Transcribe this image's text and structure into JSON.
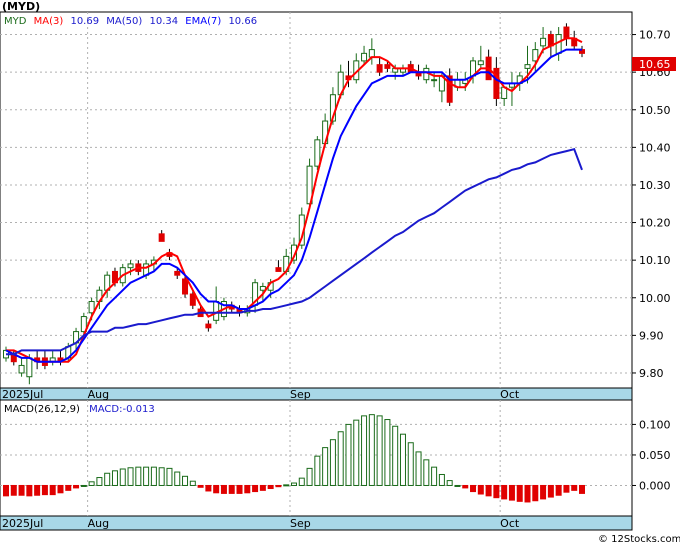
{
  "ticker_label": "(MYD)",
  "legend": {
    "symbol": "MYD",
    "ma3_label": "MA(3)",
    "ma3_value": "10.69",
    "ma50_label": "MA(50)",
    "ma50_value": "10.34",
    "ema7_label": "EMA(7)",
    "ema7_value": "10.66"
  },
  "price_badge": "10.65",
  "macd_legend": {
    "label": "MACD(26,12,9)",
    "value_label": "MACD:-0.013"
  },
  "watermark": "© 12Stocks.com",
  "colors": {
    "up": "#1a6b1a",
    "down": "#e00000",
    "ma3": "#ff0000",
    "ma50": "#1a1acd",
    "ema7": "#0000ff",
    "band": "#a8d8e8",
    "badge": "#e00000"
  },
  "chart_data": [
    {
      "type": "candlestick",
      "title": "",
      "ylim": [
        9.76,
        10.76
      ],
      "y_ticks": [
        9.8,
        9.9,
        10.0,
        10.1,
        10.2,
        10.3,
        10.4,
        10.5,
        10.6,
        10.7
      ],
      "y_tick_labels": [
        "9.80",
        "9.90",
        "10.00",
        "10.10",
        "10.20",
        "10.30",
        "10.40",
        "10.50",
        "10.60",
        "10.70"
      ],
      "x_labels": [
        {
          "label": "2025Jul",
          "index": 0
        },
        {
          "label": "Aug",
          "index": 11
        },
        {
          "label": "Sep",
          "index": 37
        },
        {
          "label": "Oct",
          "index": 64
        }
      ],
      "candles": [
        [
          9.84,
          9.87,
          9.83,
          9.86
        ],
        [
          9.85,
          9.86,
          9.82,
          9.83
        ],
        [
          9.8,
          9.84,
          9.79,
          9.82
        ],
        [
          9.79,
          9.85,
          9.77,
          9.84
        ],
        [
          9.84,
          9.86,
          9.81,
          9.83
        ],
        [
          9.84,
          9.86,
          9.81,
          9.82
        ],
        [
          9.83,
          9.86,
          9.82,
          9.84
        ],
        [
          9.84,
          9.86,
          9.82,
          9.83
        ],
        [
          9.84,
          9.88,
          9.83,
          9.87
        ],
        [
          9.88,
          9.92,
          9.86,
          9.91
        ],
        [
          9.91,
          9.96,
          9.9,
          9.95
        ],
        [
          9.96,
          10.0,
          9.94,
          9.99
        ],
        [
          9.99,
          10.03,
          9.97,
          10.02
        ],
        [
          10.02,
          10.07,
          10.0,
          10.06
        ],
        [
          10.07,
          10.08,
          10.03,
          10.04
        ],
        [
          10.04,
          10.09,
          10.03,
          10.08
        ],
        [
          10.08,
          10.1,
          10.06,
          10.09
        ],
        [
          10.09,
          10.1,
          10.06,
          10.07
        ],
        [
          10.06,
          10.1,
          10.05,
          10.09
        ],
        [
          10.09,
          10.11,
          10.07,
          10.1
        ],
        [
          10.17,
          10.18,
          10.15,
          10.15
        ],
        [
          10.12,
          10.13,
          10.1,
          10.11
        ],
        [
          10.07,
          10.08,
          10.05,
          10.06
        ],
        [
          10.05,
          10.06,
          10.0,
          10.01
        ],
        [
          10.01,
          10.02,
          9.97,
          9.98
        ],
        [
          9.97,
          9.98,
          9.95,
          9.95
        ],
        [
          9.93,
          9.94,
          9.91,
          9.92
        ],
        [
          9.94,
          10.03,
          9.93,
          9.99
        ],
        [
          9.95,
          10.0,
          9.94,
          9.99
        ],
        [
          9.98,
          9.99,
          9.96,
          9.97
        ],
        [
          9.97,
          9.98,
          9.95,
          9.96
        ],
        [
          9.96,
          9.98,
          9.95,
          9.97
        ],
        [
          9.98,
          10.05,
          9.96,
          10.04
        ],
        [
          10.02,
          10.04,
          9.99,
          10.03
        ],
        [
          10.02,
          10.05,
          10.0,
          10.04
        ],
        [
          10.08,
          10.1,
          10.07,
          10.07
        ],
        [
          10.07,
          10.13,
          10.06,
          10.11
        ],
        [
          10.1,
          10.16,
          10.09,
          10.14
        ],
        [
          10.14,
          10.24,
          10.13,
          10.22
        ],
        [
          10.25,
          10.37,
          10.24,
          10.35
        ],
        [
          10.35,
          10.43,
          10.34,
          10.42
        ],
        [
          10.41,
          10.49,
          10.4,
          10.47
        ],
        [
          10.47,
          10.56,
          10.46,
          10.54
        ],
        [
          10.54,
          10.62,
          10.53,
          10.6
        ],
        [
          10.59,
          10.63,
          10.56,
          10.58
        ],
        [
          10.58,
          10.65,
          10.57,
          10.63
        ],
        [
          10.63,
          10.67,
          10.62,
          10.65
        ],
        [
          10.64,
          10.69,
          10.62,
          10.66
        ],
        [
          10.62,
          10.64,
          10.59,
          10.6
        ],
        [
          10.62,
          10.63,
          10.6,
          10.61
        ],
        [
          10.6,
          10.62,
          10.58,
          10.61
        ],
        [
          10.6,
          10.62,
          10.59,
          10.61
        ],
        [
          10.62,
          10.63,
          10.6,
          10.6
        ],
        [
          10.6,
          10.62,
          10.58,
          10.59
        ],
        [
          10.58,
          10.62,
          10.57,
          10.61
        ],
        [
          10.58,
          10.6,
          10.56,
          10.58
        ],
        [
          10.55,
          10.6,
          10.52,
          10.59
        ],
        [
          10.59,
          10.61,
          10.51,
          10.52
        ],
        [
          10.56,
          10.6,
          10.55,
          10.58
        ],
        [
          10.57,
          10.6,
          10.55,
          10.58
        ],
        [
          10.59,
          10.64,
          10.57,
          10.63
        ],
        [
          10.62,
          10.67,
          10.61,
          10.63
        ],
        [
          10.64,
          10.66,
          10.58,
          10.58
        ],
        [
          10.61,
          10.64,
          10.51,
          10.53
        ],
        [
          10.53,
          10.56,
          10.51,
          10.56
        ],
        [
          10.56,
          10.6,
          10.51,
          10.57
        ],
        [
          10.57,
          10.6,
          10.55,
          10.59
        ],
        [
          10.61,
          10.67,
          10.57,
          10.62
        ],
        [
          10.63,
          10.68,
          10.6,
          10.66
        ],
        [
          10.67,
          10.72,
          10.65,
          10.69
        ],
        [
          10.7,
          10.71,
          10.64,
          10.67
        ],
        [
          10.65,
          10.72,
          10.63,
          10.7
        ],
        [
          10.72,
          10.73,
          10.67,
          10.69
        ],
        [
          10.69,
          10.71,
          10.66,
          10.67
        ],
        [
          10.66,
          10.67,
          10.64,
          10.65
        ]
      ],
      "series": [
        {
          "name": "MA(3)",
          "color": "#ff0000",
          "values": [
            9.86,
            9.86,
            9.85,
            9.84,
            9.83,
            9.83,
            9.83,
            9.83,
            9.83,
            9.85,
            9.9,
            9.95,
            9.99,
            10.02,
            10.04,
            10.06,
            10.07,
            10.08,
            10.08,
            10.09,
            10.11,
            10.12,
            10.11,
            10.06,
            10.02,
            9.98,
            9.95,
            9.96,
            9.97,
            9.98,
            9.97,
            9.97,
            9.99,
            10.01,
            10.04,
            10.05,
            10.07,
            10.11,
            10.16,
            10.24,
            10.33,
            10.41,
            10.48,
            10.54,
            10.58,
            10.6,
            10.62,
            10.64,
            10.64,
            10.63,
            10.61,
            10.61,
            10.61,
            10.6,
            10.6,
            10.59,
            10.59,
            10.57,
            10.56,
            10.56,
            10.59,
            10.61,
            10.61,
            10.59,
            10.56,
            10.55,
            10.57,
            10.59,
            10.62,
            10.66,
            10.67,
            10.68,
            10.69,
            10.69,
            10.68
          ]
        },
        {
          "name": "EMA(7)",
          "color": "#0000ff",
          "values": [
            9.86,
            9.85,
            9.84,
            9.84,
            9.83,
            9.83,
            9.83,
            9.83,
            9.84,
            9.86,
            9.89,
            9.92,
            9.95,
            9.98,
            10.0,
            10.02,
            10.04,
            10.05,
            10.06,
            10.07,
            10.09,
            10.09,
            10.08,
            10.06,
            10.04,
            10.01,
            9.99,
            9.99,
            9.98,
            9.98,
            9.97,
            9.97,
            9.98,
            9.99,
            10.01,
            10.02,
            10.04,
            10.06,
            10.1,
            10.16,
            10.23,
            10.3,
            10.37,
            10.43,
            10.47,
            10.51,
            10.54,
            10.57,
            10.58,
            10.59,
            10.59,
            10.59,
            10.6,
            10.6,
            10.6,
            10.6,
            10.6,
            10.58,
            10.58,
            10.58,
            10.59,
            10.6,
            10.6,
            10.58,
            10.57,
            10.57,
            10.57,
            10.58,
            10.6,
            10.62,
            10.64,
            10.65,
            10.66,
            10.66,
            10.66
          ]
        },
        {
          "name": "MA(50)",
          "color": "#1a1acd",
          "values": [
            9.85,
            9.85,
            9.86,
            9.86,
            9.86,
            9.86,
            9.86,
            9.86,
            9.87,
            9.88,
            9.9,
            9.91,
            9.91,
            9.91,
            9.92,
            9.92,
            9.925,
            9.93,
            9.93,
            9.935,
            9.94,
            9.945,
            9.95,
            9.955,
            9.955,
            9.96,
            9.96,
            9.96,
            9.96,
            9.96,
            9.96,
            9.965,
            9.965,
            9.97,
            9.97,
            9.975,
            9.98,
            9.985,
            9.99,
            10.0,
            10.015,
            10.03,
            10.045,
            10.06,
            10.075,
            10.09,
            10.105,
            10.12,
            10.135,
            10.15,
            10.165,
            10.175,
            10.19,
            10.205,
            10.215,
            10.225,
            10.24,
            10.255,
            10.27,
            10.285,
            10.295,
            10.305,
            10.315,
            10.32,
            10.33,
            10.34,
            10.345,
            10.355,
            10.36,
            10.37,
            10.38,
            10.385,
            10.39,
            10.395,
            10.34
          ]
        }
      ]
    },
    {
      "type": "bar",
      "title": "MACD(26,12,9)",
      "ylim": [
        -0.05,
        0.14
      ],
      "y_ticks": [
        0.0,
        0.05,
        0.1
      ],
      "y_tick_labels": [
        "0.000",
        "0.050",
        "0.100"
      ],
      "x_labels": [
        {
          "label": "2025Jul",
          "index": 0
        },
        {
          "label": "Aug",
          "index": 11
        },
        {
          "label": "Sep",
          "index": 37
        },
        {
          "label": "Oct",
          "index": 64
        }
      ],
      "values": [
        -0.017,
        -0.016,
        -0.016,
        -0.017,
        -0.016,
        -0.015,
        -0.015,
        -0.012,
        -0.008,
        -0.004,
        0.0,
        0.006,
        0.013,
        0.02,
        0.024,
        0.027,
        0.029,
        0.03,
        0.03,
        0.03,
        0.029,
        0.028,
        0.022,
        0.015,
        0.007,
        -0.003,
        -0.009,
        -0.012,
        -0.013,
        -0.013,
        -0.013,
        -0.012,
        -0.01,
        -0.008,
        -0.005,
        -0.002,
        0.001,
        0.004,
        0.012,
        0.028,
        0.048,
        0.062,
        0.075,
        0.088,
        0.1,
        0.107,
        0.114,
        0.116,
        0.114,
        0.108,
        0.097,
        0.084,
        0.07,
        0.055,
        0.042,
        0.03,
        0.018,
        0.008,
        0.0,
        -0.004,
        -0.01,
        -0.014,
        -0.017,
        -0.02,
        -0.022,
        -0.024,
        -0.026,
        -0.027,
        -0.025,
        -0.022,
        -0.019,
        -0.016,
        -0.011,
        -0.008,
        -0.013
      ]
    }
  ]
}
